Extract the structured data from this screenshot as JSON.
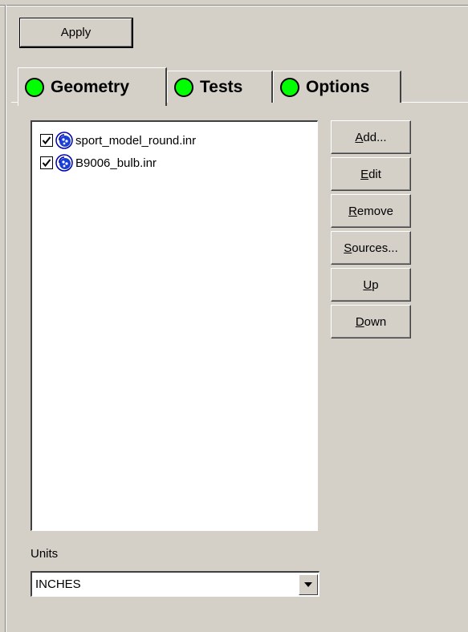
{
  "toolbar": {
    "apply_label": "Apply"
  },
  "tabs": [
    {
      "label": "Geometry",
      "status_color": "#00ff00",
      "active": true
    },
    {
      "label": "Tests",
      "status_color": "#00ff00",
      "active": false
    },
    {
      "label": "Options",
      "status_color": "#00ff00",
      "active": false
    }
  ],
  "geometry_list": {
    "items": [
      {
        "label": "sport_model_round.inr",
        "checked": true,
        "icon": "geometry-file-icon"
      },
      {
        "label": "B9006_bulb.inr",
        "checked": true,
        "icon": "geometry-file-icon"
      }
    ]
  },
  "side_buttons": {
    "add": {
      "mnemonic": "A",
      "rest": "dd..."
    },
    "edit": {
      "mnemonic": "E",
      "rest": "dit"
    },
    "remove": {
      "mnemonic": "R",
      "rest": "emove"
    },
    "sources": {
      "mnemonic": "S",
      "rest": "ources..."
    },
    "up": {
      "mnemonic": "U",
      "rest": "p"
    },
    "down": {
      "mnemonic": "D",
      "rest": "own"
    }
  },
  "units": {
    "label": "Units",
    "selected": "INCHES"
  }
}
